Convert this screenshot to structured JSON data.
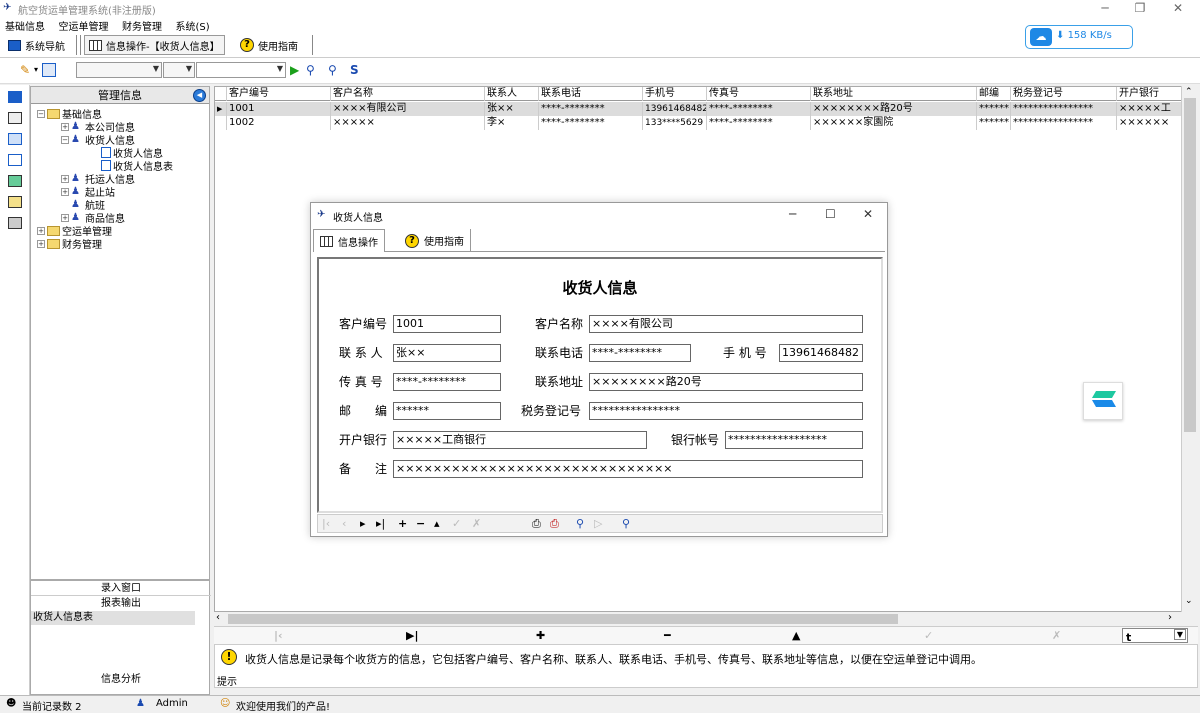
{
  "window": {
    "title": "航空货运单管理系统(非注册版)"
  },
  "menu": [
    "基础信息",
    "空运单管理",
    "财务管理",
    "系统(S)"
  ],
  "navbar": {
    "nav_label": "系统导航",
    "info_label": "信息操作-【收货人信息】",
    "guide_label": "使用指南"
  },
  "speed": {
    "value": "158 KB/s"
  },
  "tree": {
    "header": "管理信息",
    "nodes": [
      {
        "label": "基础信息",
        "level": 0,
        "pm": "−",
        "icon": "folder"
      },
      {
        "label": "本公司信息",
        "level": 1,
        "pm": "+",
        "icon": "person"
      },
      {
        "label": "收货人信息",
        "level": 1,
        "pm": "−",
        "icon": "person"
      },
      {
        "label": "收货人信息",
        "level": 2,
        "pm": "",
        "icon": "doc"
      },
      {
        "label": "收货人信息表",
        "level": 2,
        "pm": "",
        "icon": "doc"
      },
      {
        "label": "托运人信息",
        "level": 1,
        "pm": "+",
        "icon": "person"
      },
      {
        "label": "起止站",
        "level": 1,
        "pm": "+",
        "icon": "person"
      },
      {
        "label": "航班",
        "level": 1,
        "pm": "",
        "icon": "person"
      },
      {
        "label": "商品信息",
        "level": 1,
        "pm": "+",
        "icon": "person"
      },
      {
        "label": "空运单管理",
        "level": 0,
        "pm": "+",
        "icon": "folder"
      },
      {
        "label": "财务管理",
        "level": 0,
        "pm": "+",
        "icon": "folder"
      }
    ]
  },
  "left_bottom": {
    "entry": "录入窗口",
    "report": "报表输出",
    "selected": "收货人信息表",
    "analysis": "信息分析"
  },
  "table": {
    "columns": [
      "客户编号",
      "客户名称",
      "联系人",
      "联系电话",
      "手机号",
      "传真号",
      "联系地址",
      "邮编",
      "税务登记号",
      "开户银行"
    ],
    "rows": [
      [
        "1001",
        "××××有限公司",
        "张××",
        "****-********",
        "13961468482",
        "****-********",
        "××××××××路20号",
        "******",
        "****************",
        "×××××工"
      ],
      [
        "1002",
        "×××××",
        "李×",
        "****-********",
        "133****5629",
        "****-********",
        "××××××家園院",
        "******",
        "****************",
        "××××××"
      ]
    ]
  },
  "navrow": {
    "combo_value": "t"
  },
  "tip": {
    "text": "收货人信息是记录每个收货方的信息，它包括客户编号、客户名称、联系人、联系电话、手机号、传真号、联系地址等信息，以便在空运单登记中调用。",
    "label": "提示"
  },
  "status": {
    "records": "当前记录数 2",
    "user": "Admin",
    "welcome": "欢迎使用我们的产品!"
  },
  "dialog": {
    "title": "收货人信息",
    "tab1": "信息操作",
    "tab2": "使用指南",
    "heading": "收货人信息",
    "labels": {
      "id": "客户编号",
      "name": "客户名称",
      "contact": "联 系 人",
      "phone": "联系电话",
      "mobile": "手 机 号",
      "fax": "传 真 号",
      "address": "联系地址",
      "zip": "邮　　编",
      "tax": "税务登记号",
      "bank": "开户银行",
      "account": "银行帐号",
      "note": "备　　注"
    },
    "values": {
      "id": "1001",
      "name": "××××有限公司",
      "contact": "张××",
      "phone": "****-********",
      "mobile": "13961468482",
      "fax": "****-********",
      "address": "××××××××路20号",
      "zip": "******",
      "tax": "****************",
      "bank": "×××××工商银行",
      "account": "******************",
      "note": "××××××××××××××××××××××××××××××"
    }
  }
}
